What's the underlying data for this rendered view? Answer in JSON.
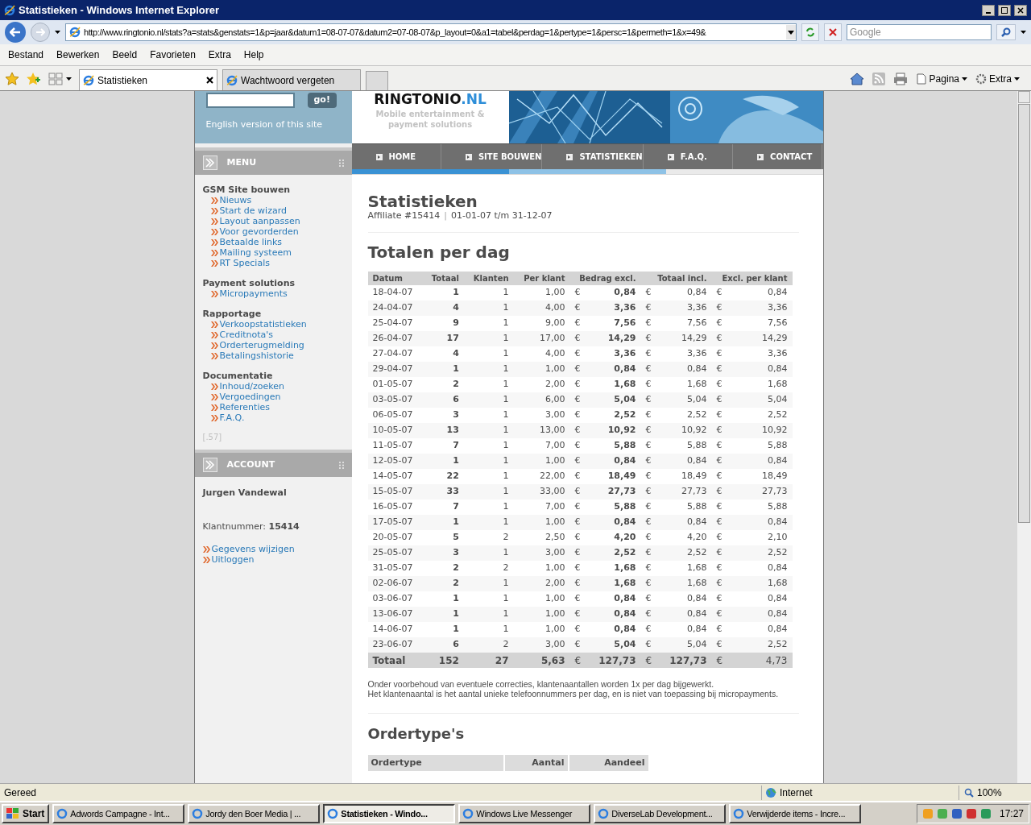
{
  "window": {
    "title": "Statistieken - Windows Internet Explorer"
  },
  "address": {
    "url": "http://www.ringtonio.nl/stats?a=stats&genstats=1&p=jaar&datum1=08-07-07&datum2=07-08-07&p_layout=0&a1=tabel&perdag=1&pertype=1&persc=1&permeth=1&x=49&"
  },
  "search": {
    "placeholder": "Google"
  },
  "menu": [
    "Bestand",
    "Bewerken",
    "Beeld",
    "Favorieten",
    "Extra",
    "Help"
  ],
  "tabs": [
    {
      "label": "Statistieken",
      "selected": true
    },
    {
      "label": "Wachtwoord vergeten",
      "selected": false
    }
  ],
  "toolbar": [
    "Pagina",
    "Extra"
  ],
  "site": {
    "go_button": "go!",
    "english_link": "English version of this site",
    "logo": {
      "name": "RINGTONIO",
      "suffix": ".NL",
      "tagline": "Mobile entertainment & payment solutions"
    },
    "nav": [
      "HOME",
      "SITE BOUWEN",
      "STATISTIEKEN",
      "F.A.Q.",
      "CONTACT"
    ],
    "menu_header": "MENU",
    "sections": [
      {
        "heading": "GSM Site bouwen",
        "items": [
          "Nieuws",
          "Start de wizard",
          "Layout aanpassen",
          "Voor gevorderden",
          "Betaalde links",
          "Mailing systeem",
          "RT Specials"
        ]
      },
      {
        "heading": "Payment solutions",
        "items": [
          "Micropayments"
        ]
      },
      {
        "heading": "Rapportage",
        "items": [
          "Verkoopstatistieken",
          "Creditnota's",
          "Orderterugmelding",
          "Betalingshistorie"
        ]
      },
      {
        "heading": "Documentatie",
        "items": [
          "Inhoud/zoeken",
          "Vergoedingen",
          "Referenties",
          "F.A.Q."
        ]
      }
    ],
    "version": "[.57]",
    "account": {
      "header": "ACCOUNT",
      "name": "Jurgen Vandewal",
      "number_label": "Klantnummer:",
      "number": "15414",
      "links": [
        "Gegevens wijzigen",
        "Uitloggen"
      ]
    }
  },
  "main": {
    "title": "Statistieken",
    "affiliate": "Affiliate #15414",
    "separator": "|",
    "period": "01-01-07 t/m 31-12-07",
    "section_title": "Totalen per dag",
    "columns": [
      "Datum",
      "Totaal",
      "Klanten",
      "Per klant",
      "Bedrag excl.",
      "Totaal incl.",
      "Excl. per klant"
    ],
    "rows": [
      [
        "18-04-07",
        "1",
        "1",
        "1,00",
        {
          "currency": "€",
          "amount": "0,84"
        },
        {
          "currency": "€",
          "amount": "0,84"
        },
        {
          "currency": "€",
          "amount": "0,84"
        }
      ],
      [
        "24-04-07",
        "4",
        "1",
        "4,00",
        {
          "currency": "€",
          "amount": "3,36"
        },
        {
          "currency": "€",
          "amount": "3,36"
        },
        {
          "currency": "€",
          "amount": "3,36"
        }
      ],
      [
        "25-04-07",
        "9",
        "1",
        "9,00",
        {
          "currency": "€",
          "amount": "7,56"
        },
        {
          "currency": "€",
          "amount": "7,56"
        },
        {
          "currency": "€",
          "amount": "7,56"
        }
      ],
      [
        "26-04-07",
        "17",
        "1",
        "17,00",
        {
          "currency": "€",
          "amount": "14,29"
        },
        {
          "currency": "€",
          "amount": "14,29"
        },
        {
          "currency": "€",
          "amount": "14,29"
        }
      ],
      [
        "27-04-07",
        "4",
        "1",
        "4,00",
        {
          "currency": "€",
          "amount": "3,36"
        },
        {
          "currency": "€",
          "amount": "3,36"
        },
        {
          "currency": "€",
          "amount": "3,36"
        }
      ],
      [
        "29-04-07",
        "1",
        "1",
        "1,00",
        {
          "currency": "€",
          "amount": "0,84"
        },
        {
          "currency": "€",
          "amount": "0,84"
        },
        {
          "currency": "€",
          "amount": "0,84"
        }
      ],
      [
        "01-05-07",
        "2",
        "1",
        "2,00",
        {
          "currency": "€",
          "amount": "1,68"
        },
        {
          "currency": "€",
          "amount": "1,68"
        },
        {
          "currency": "€",
          "amount": "1,68"
        }
      ],
      [
        "03-05-07",
        "6",
        "1",
        "6,00",
        {
          "currency": "€",
          "amount": "5,04"
        },
        {
          "currency": "€",
          "amount": "5,04"
        },
        {
          "currency": "€",
          "amount": "5,04"
        }
      ],
      [
        "06-05-07",
        "3",
        "1",
        "3,00",
        {
          "currency": "€",
          "amount": "2,52"
        },
        {
          "currency": "€",
          "amount": "2,52"
        },
        {
          "currency": "€",
          "amount": "2,52"
        }
      ],
      [
        "10-05-07",
        "13",
        "1",
        "13,00",
        {
          "currency": "€",
          "amount": "10,92"
        },
        {
          "currency": "€",
          "amount": "10,92"
        },
        {
          "currency": "€",
          "amount": "10,92"
        }
      ],
      [
        "11-05-07",
        "7",
        "1",
        "7,00",
        {
          "currency": "€",
          "amount": "5,88"
        },
        {
          "currency": "€",
          "amount": "5,88"
        },
        {
          "currency": "€",
          "amount": "5,88"
        }
      ],
      [
        "12-05-07",
        "1",
        "1",
        "1,00",
        {
          "currency": "€",
          "amount": "0,84"
        },
        {
          "currency": "€",
          "amount": "0,84"
        },
        {
          "currency": "€",
          "amount": "0,84"
        }
      ],
      [
        "14-05-07",
        "22",
        "1",
        "22,00",
        {
          "currency": "€",
          "amount": "18,49"
        },
        {
          "currency": "€",
          "amount": "18,49"
        },
        {
          "currency": "€",
          "amount": "18,49"
        }
      ],
      [
        "15-05-07",
        "33",
        "1",
        "33,00",
        {
          "currency": "€",
          "amount": "27,73"
        },
        {
          "currency": "€",
          "amount": "27,73"
        },
        {
          "currency": "€",
          "amount": "27,73"
        }
      ],
      [
        "16-05-07",
        "7",
        "1",
        "7,00",
        {
          "currency": "€",
          "amount": "5,88"
        },
        {
          "currency": "€",
          "amount": "5,88"
        },
        {
          "currency": "€",
          "amount": "5,88"
        }
      ],
      [
        "17-05-07",
        "1",
        "1",
        "1,00",
        {
          "currency": "€",
          "amount": "0,84"
        },
        {
          "currency": "€",
          "amount": "0,84"
        },
        {
          "currency": "€",
          "amount": "0,84"
        }
      ],
      [
        "20-05-07",
        "5",
        "2",
        "2,50",
        {
          "currency": "€",
          "amount": "4,20"
        },
        {
          "currency": "€",
          "amount": "4,20"
        },
        {
          "currency": "€",
          "amount": "2,10"
        }
      ],
      [
        "25-05-07",
        "3",
        "1",
        "3,00",
        {
          "currency": "€",
          "amount": "2,52"
        },
        {
          "currency": "€",
          "amount": "2,52"
        },
        {
          "currency": "€",
          "amount": "2,52"
        }
      ],
      [
        "31-05-07",
        "2",
        "2",
        "1,00",
        {
          "currency": "€",
          "amount": "1,68"
        },
        {
          "currency": "€",
          "amount": "1,68"
        },
        {
          "currency": "€",
          "amount": "0,84"
        }
      ],
      [
        "02-06-07",
        "2",
        "1",
        "2,00",
        {
          "currency": "€",
          "amount": "1,68"
        },
        {
          "currency": "€",
          "amount": "1,68"
        },
        {
          "currency": "€",
          "amount": "1,68"
        }
      ],
      [
        "03-06-07",
        "1",
        "1",
        "1,00",
        {
          "currency": "€",
          "amount": "0,84"
        },
        {
          "currency": "€",
          "amount": "0,84"
        },
        {
          "currency": "€",
          "amount": "0,84"
        }
      ],
      [
        "13-06-07",
        "1",
        "1",
        "1,00",
        {
          "currency": "€",
          "amount": "0,84"
        },
        {
          "currency": "€",
          "amount": "0,84"
        },
        {
          "currency": "€",
          "amount": "0,84"
        }
      ],
      [
        "14-06-07",
        "1",
        "1",
        "1,00",
        {
          "currency": "€",
          "amount": "0,84"
        },
        {
          "currency": "€",
          "amount": "0,84"
        },
        {
          "currency": "€",
          "amount": "0,84"
        }
      ],
      [
        "23-06-07",
        "6",
        "2",
        "3,00",
        {
          "currency": "€",
          "amount": "5,04"
        },
        {
          "currency": "€",
          "amount": "5,04"
        },
        {
          "currency": "€",
          "amount": "2,52"
        }
      ]
    ],
    "total": [
      "Totaal",
      "152",
      "27",
      "5,63",
      {
        "currency": "€",
        "amount": "127,73"
      },
      {
        "currency": "€",
        "amount": "127,73"
      },
      {
        "currency": "€",
        "amount": "4,73"
      }
    ],
    "notes": [
      "Onder voorbehoud van eventuele correcties, klantenaantallen worden 1x per dag bijgewerkt.",
      "Het klantenaantal is het aantal unieke telefoonnummers per dag, en is niet van toepassing bij micropayments."
    ],
    "ordertypes_title": "Ordertype's",
    "ordertypes_columns": [
      "Ordertype",
      "Aantal",
      "Aandeel"
    ]
  },
  "status_bar": {
    "text": "Gereed",
    "zone": "Internet",
    "zoom": "100%"
  },
  "taskbar": {
    "start": "Start",
    "items": [
      {
        "label": "Adwords Campagne - Int...",
        "selected": false
      },
      {
        "label": "Jordy den Boer Media | ...",
        "selected": false
      },
      {
        "label": "Statistieken - Windo...",
        "selected": true
      },
      {
        "label": "Windows Live Messenger",
        "selected": false
      },
      {
        "label": "DiverseLab Development...",
        "selected": false
      },
      {
        "label": "Verwijderde items - Incre...",
        "selected": false
      }
    ],
    "clock": "17:27"
  }
}
